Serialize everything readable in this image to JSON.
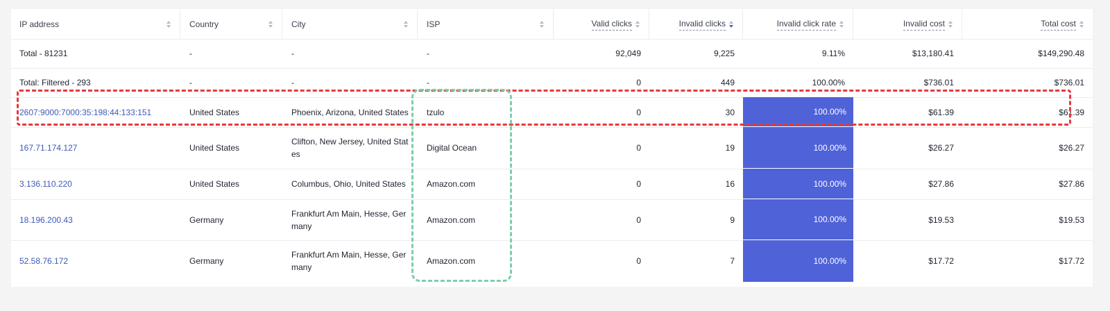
{
  "columns": {
    "ip": "IP address",
    "country": "Country",
    "city": "City",
    "isp": "ISP",
    "valid_clicks": "Valid clicks",
    "invalid_clicks": "Invalid clicks",
    "invalid_click_rate": "Invalid click rate",
    "invalid_cost": "Invalid cost",
    "total_cost": "Total cost"
  },
  "totals": [
    {
      "label": "Total - 81231",
      "country": "-",
      "city": "-",
      "isp": "-",
      "valid_clicks": "92,049",
      "invalid_clicks": "9,225",
      "invalid_click_rate": "9.11%",
      "invalid_cost": "$13,180.41",
      "total_cost": "$149,290.48"
    },
    {
      "label": "Total: Filtered - 293",
      "country": "-",
      "city": "-",
      "isp": "-",
      "valid_clicks": "0",
      "invalid_clicks": "449",
      "invalid_click_rate": "100.00%",
      "invalid_cost": "$736.01",
      "total_cost": "$736.01"
    }
  ],
  "rows": [
    {
      "ip": "2607:9000:7000:35:198:44:133:151",
      "country": "United States",
      "city": "Phoenix, Arizona, United States",
      "isp": "tzulo",
      "valid_clicks": "0",
      "invalid_clicks": "30",
      "invalid_click_rate": "100.00%",
      "invalid_cost": "$61.39",
      "total_cost": "$61.39"
    },
    {
      "ip": "167.71.174.127",
      "country": "United States",
      "city": "Clifton, New Jersey, United States",
      "isp": "Digital Ocean",
      "valid_clicks": "0",
      "invalid_clicks": "19",
      "invalid_click_rate": "100.00%",
      "invalid_cost": "$26.27",
      "total_cost": "$26.27"
    },
    {
      "ip": "3.136.110.220",
      "country": "United States",
      "city": "Columbus, Ohio, United States",
      "isp": "Amazon.com",
      "valid_clicks": "0",
      "invalid_clicks": "16",
      "invalid_click_rate": "100.00%",
      "invalid_cost": "$27.86",
      "total_cost": "$27.86"
    },
    {
      "ip": "18.196.200.43",
      "country": "Germany",
      "city": "Frankfurt Am Main, Hesse, Germany",
      "isp": "Amazon.com",
      "valid_clicks": "0",
      "invalid_clicks": "9",
      "invalid_click_rate": "100.00%",
      "invalid_cost": "$19.53",
      "total_cost": "$19.53"
    },
    {
      "ip": "52.58.76.172",
      "country": "Germany",
      "city": "Frankfurt Am Main, Hesse, Germany",
      "isp": "Amazon.com",
      "valid_clicks": "0",
      "invalid_clicks": "7",
      "invalid_click_rate": "100.00%",
      "invalid_cost": "$17.72",
      "total_cost": "$17.72"
    }
  ],
  "colors": {
    "rate_fill": "#4f62d8",
    "highlight_red": "#e5393b",
    "highlight_green": "#7ccfa9",
    "link": "#3d5ab8"
  },
  "sort": {
    "active_column": "invalid_clicks",
    "direction": "desc"
  }
}
